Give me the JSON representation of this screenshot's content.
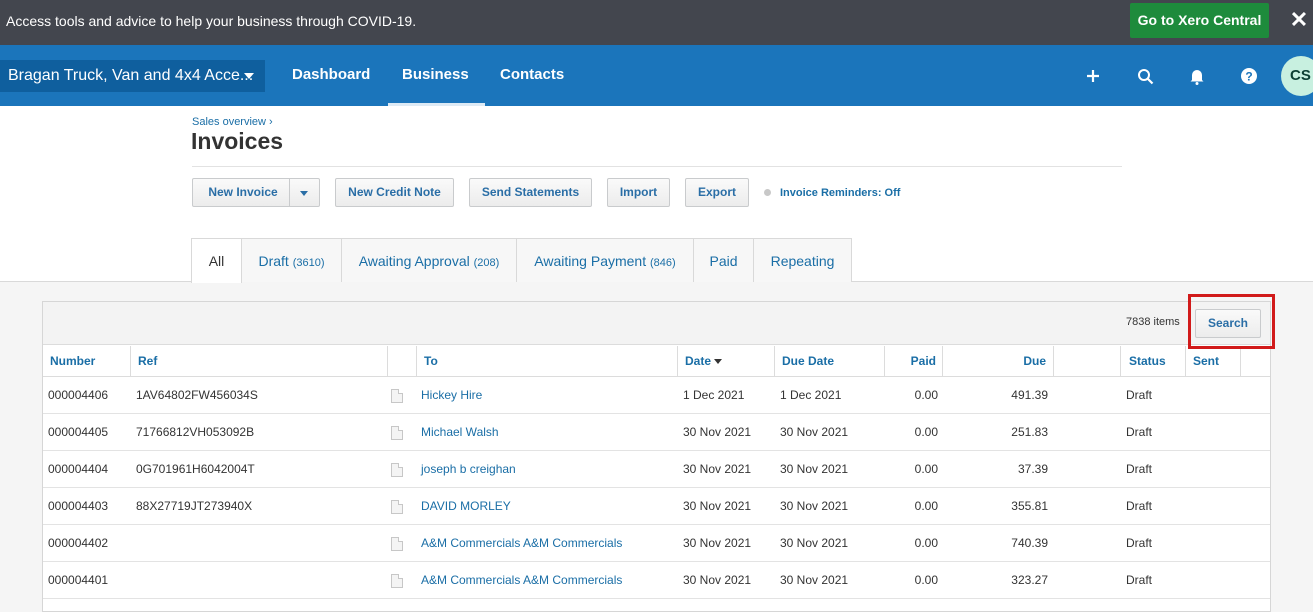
{
  "banner": {
    "text": "Access tools and advice to help your business through COVID-19.",
    "cta_label": "Go to Xero Central",
    "close_label": "✕"
  },
  "nav": {
    "org_name": "Bragan Truck, Van and 4x4 Acce...",
    "links": [
      "Dashboard",
      "Business",
      "Contacts"
    ],
    "active_link": "Business",
    "avatar_initials": "CS"
  },
  "page": {
    "breadcrumb": "Sales overview ›",
    "title": "Invoices",
    "buttons": {
      "new_invoice": "New Invoice",
      "new_credit_note": "New Credit Note",
      "send_statements": "Send Statements",
      "import": "Import",
      "export": "Export"
    },
    "reminders": "Invoice Reminders: Off"
  },
  "tabs": [
    {
      "label": "All",
      "count": ""
    },
    {
      "label": "Draft",
      "count": "(3610)"
    },
    {
      "label": "Awaiting Approval",
      "count": "(208)"
    },
    {
      "label": "Awaiting Payment",
      "count": "(846)"
    },
    {
      "label": "Paid",
      "count": ""
    },
    {
      "label": "Repeating",
      "count": ""
    }
  ],
  "table": {
    "items_count": "7838 items",
    "search_label": "Search",
    "columns": {
      "number": "Number",
      "ref": "Ref",
      "to": "To",
      "date": "Date",
      "due_date": "Due Date",
      "paid": "Paid",
      "due": "Due",
      "status": "Status",
      "sent": "Sent"
    },
    "rows": [
      {
        "number": "000004406",
        "ref": "1AV64802FW456034S",
        "to": "Hickey Hire",
        "date": "1 Dec 2021",
        "due_date": "1 Dec 2021",
        "paid": "0.00",
        "due": "491.39",
        "status": "Draft"
      },
      {
        "number": "000004405",
        "ref": "71766812VH053092B",
        "to": "Michael Walsh",
        "date": "30 Nov 2021",
        "due_date": "30 Nov 2021",
        "paid": "0.00",
        "due": "251.83",
        "status": "Draft"
      },
      {
        "number": "000004404",
        "ref": "0G701961H6042004T",
        "to": "joseph b creighan",
        "date": "30 Nov 2021",
        "due_date": "30 Nov 2021",
        "paid": "0.00",
        "due": "37.39",
        "status": "Draft"
      },
      {
        "number": "000004403",
        "ref": "88X27719JT273940X",
        "to": "DAVID MORLEY",
        "date": "30 Nov 2021",
        "due_date": "30 Nov 2021",
        "paid": "0.00",
        "due": "355.81",
        "status": "Draft"
      },
      {
        "number": "000004402",
        "ref": "",
        "to": "A&M Commercials A&M Commercials",
        "date": "30 Nov 2021",
        "due_date": "30 Nov 2021",
        "paid": "0.00",
        "due": "740.39",
        "status": "Draft"
      },
      {
        "number": "000004401",
        "ref": "",
        "to": "A&M Commercials A&M Commercials",
        "date": "30 Nov 2021",
        "due_date": "30 Nov 2021",
        "paid": "0.00",
        "due": "323.27",
        "status": "Draft"
      }
    ]
  },
  "colors": {
    "nav_blue": "#1b75bb",
    "banner_gray": "#43464e",
    "cta_green": "#1e8b3c",
    "link_blue": "#1a6ea6",
    "highlight_red": "#d11a1a"
  }
}
